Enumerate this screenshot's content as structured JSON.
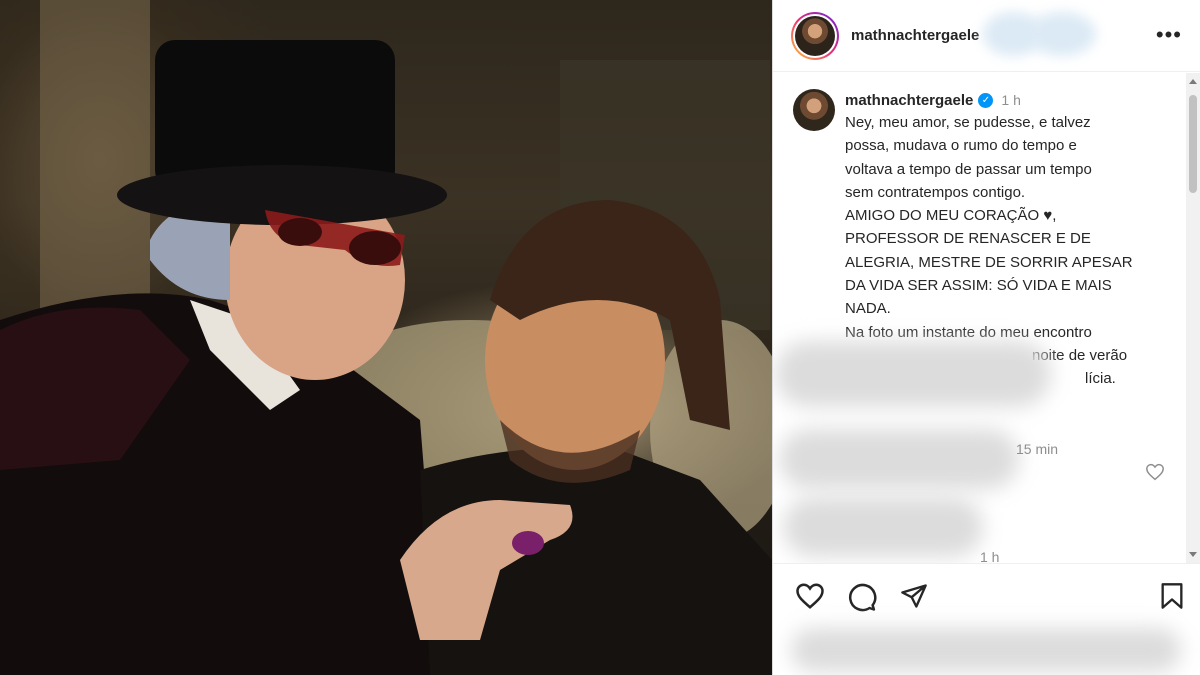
{
  "post": {
    "username": "mathnachtergaele",
    "icons": {
      "more": "more-options-icon",
      "verified": "verified-badge-icon",
      "like": "heart-icon",
      "comment": "comment-icon",
      "share": "share-icon",
      "save": "bookmark-icon"
    },
    "more_label": "•••",
    "verified_mark": "✓"
  },
  "caption": {
    "username": "mathnachtergaele",
    "time": "1 h",
    "lines": [
      "Ney, meu amor, se pudesse, e talvez",
      "possa, mudava o rumo do tempo e",
      "voltava a tempo de passar um tempo",
      "sem contratempos contigo.",
      "AMIGO DO MEU CORAÇÃO ♥,",
      "PROFESSOR DE RENASCER E DE",
      "ALEGRIA, MESTRE DE SORRIR APESAR",
      "DA VIDA SER ASSIM: SÓ VIDA E MAIS",
      "NADA.",
      "Na foto um instante do meu encontro"
    ],
    "partial_fragments": [
      "noite de verão",
      "lícia."
    ]
  },
  "comments": [
    {
      "time": "15 min"
    },
    {
      "time": "1 h"
    }
  ],
  "colors": {
    "accent": "#0095f6",
    "text": "#262626",
    "muted": "#8e8e8e"
  }
}
